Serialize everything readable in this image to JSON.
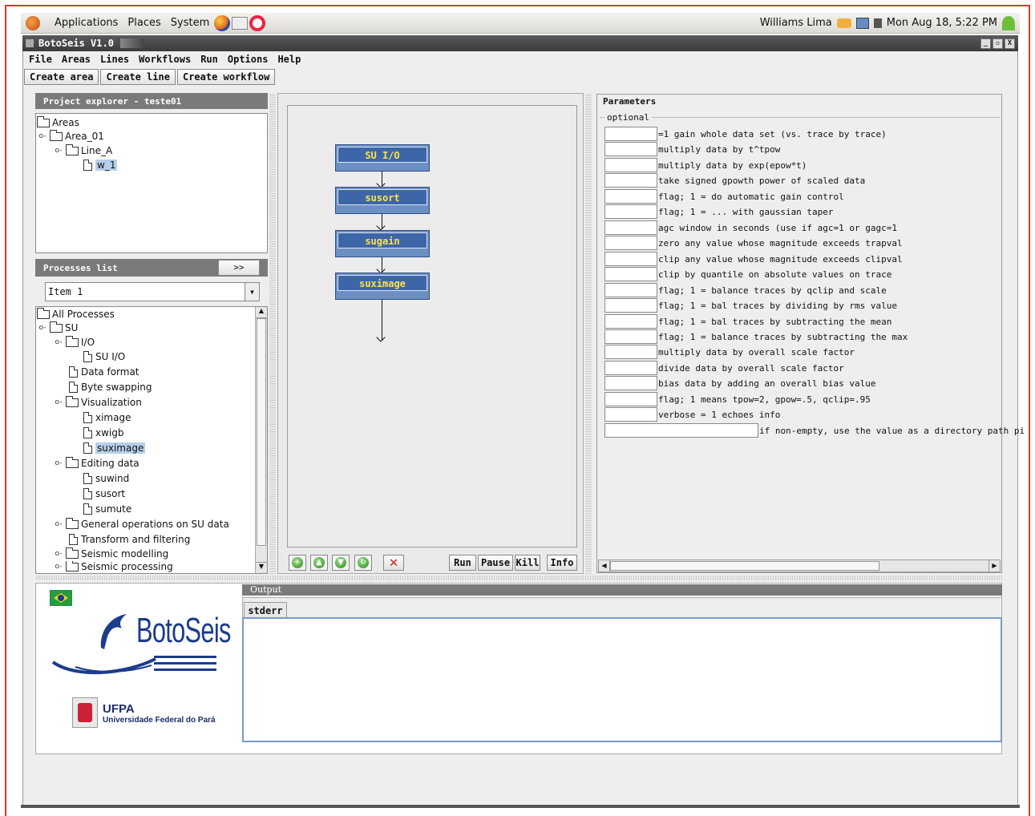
{
  "gnome_panel": {
    "menus": [
      "Applications",
      "Places",
      "System"
    ],
    "user": "Williams Lima",
    "datetime": "Mon Aug 18,  5:22 PM"
  },
  "window": {
    "title": "BotoSeis V1.0",
    "buttons": [
      "_",
      "▫",
      "X"
    ]
  },
  "menubar": [
    "File",
    "Areas",
    "Lines",
    "Workflows",
    "Run",
    "Options",
    "Help"
  ],
  "toolbar": [
    "Create area",
    "Create line",
    "Create workflow"
  ],
  "project_explorer": {
    "header": "Project explorer - teste01",
    "tree": [
      "Areas",
      "Area_01",
      "Line_A",
      "w_1"
    ]
  },
  "processes": {
    "header": "Processes list",
    "expand_label": ">>",
    "combo_value": "Item 1",
    "tree": [
      "All Processes",
      "SU",
      "I/O",
      "SU I/O",
      "Data format",
      "Byte swapping",
      "Visualization",
      "ximage",
      "xwigb",
      "suximage",
      "Editing data",
      "suwind",
      "susort",
      "sumute",
      "General operations on SU data",
      "Transform and filtering",
      "Seismic modelling",
      "Seismic processing"
    ]
  },
  "workflow": {
    "boxes": [
      "SU I/O",
      "susort",
      "sugain",
      "suximage"
    ],
    "controls": [
      "Run",
      "Pause",
      "Kill",
      "Info"
    ],
    "delete_glyph": "✕"
  },
  "parameters": {
    "title": "Parameters",
    "group": "optional",
    "rows": [
      "=1 gain whole data set (vs. trace by trace)",
      "multiply data by t^tpow",
      "multiply data by exp(epow*t)",
      "take signed gpowth power of scaled data",
      "flag; 1 = do automatic gain control",
      "flag; 1 = ... with gaussian taper",
      "agc window in seconds (use if agc=1 or gagc=1",
      "zero any value whose magnitude exceeds trapval",
      "clip any value whose magnitude exceeds clipval",
      "clip by quantile on absolute values on trace",
      "flag; 1 = balance traces by qclip and scale",
      "flag; 1 = bal traces by dividing by rms value",
      "flag; 1 = bal traces by subtracting the mean",
      "flag; 1 = balance traces by subtracting the max",
      "multiply data by overall scale factor",
      "divide data by overall scale factor",
      "bias data by adding an overall bias value",
      "flag; 1 means tpow=2, gpow=.5, qclip=.95",
      "verbose = 1 echoes info"
    ],
    "last_row": "if non-empty, use the value as a directory path pi"
  },
  "branding": {
    "product": "BotoSeis",
    "university_abbr": "UFPA",
    "university_name": "Universidade Federal do Pará"
  },
  "output": {
    "header": "Output",
    "tab": "stderr"
  },
  "colors": {
    "panel_header": "#7a7a7a",
    "workflow_box": "#3d66a8",
    "workflow_text": "#ffe24a",
    "selection": "#b8cfe8",
    "frame_border": "#d93a2a"
  }
}
